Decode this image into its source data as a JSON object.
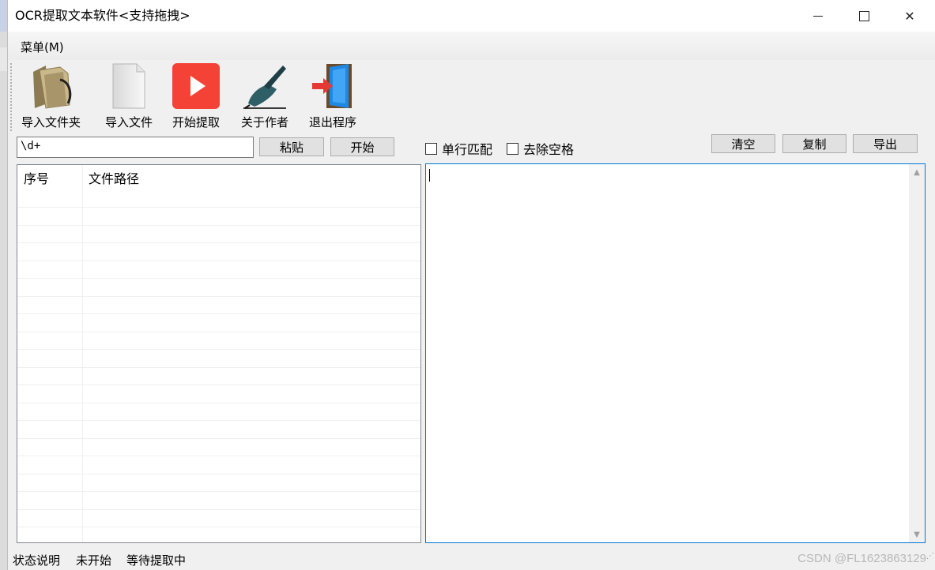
{
  "window": {
    "title": "OCR提取文本软件<支持拖拽>",
    "controls": {
      "minimize": "minimize",
      "maximize": "maximize",
      "close": "✕"
    }
  },
  "menubar": {
    "menu_label": "菜单(M)"
  },
  "toolbar": [
    {
      "label": "导入文件夹",
      "icon": "folder-icon"
    },
    {
      "label": "导入文件",
      "icon": "file-icon"
    },
    {
      "label": "开始提取",
      "icon": "play-icon"
    },
    {
      "label": "关于作者",
      "icon": "pen-hand-icon"
    },
    {
      "label": "退出程序",
      "icon": "exit-door-icon"
    }
  ],
  "controls": {
    "regex_value": "\\d+",
    "paste_label": "粘贴",
    "start_label": "开始",
    "single_line_label": "单行匹配",
    "remove_spaces_label": "去除空格",
    "clear_label": "清空",
    "copy_label": "复制",
    "export_label": "导出"
  },
  "list": {
    "headers": [
      "序号",
      "文件路径"
    ]
  },
  "status": {
    "label": "状态说明",
    "state": "未开始",
    "detail": "等待提取中"
  },
  "watermark": "CSDN @FL1623863129",
  "colors": {
    "accent": "#0078d7",
    "play_red": "#f44336"
  }
}
